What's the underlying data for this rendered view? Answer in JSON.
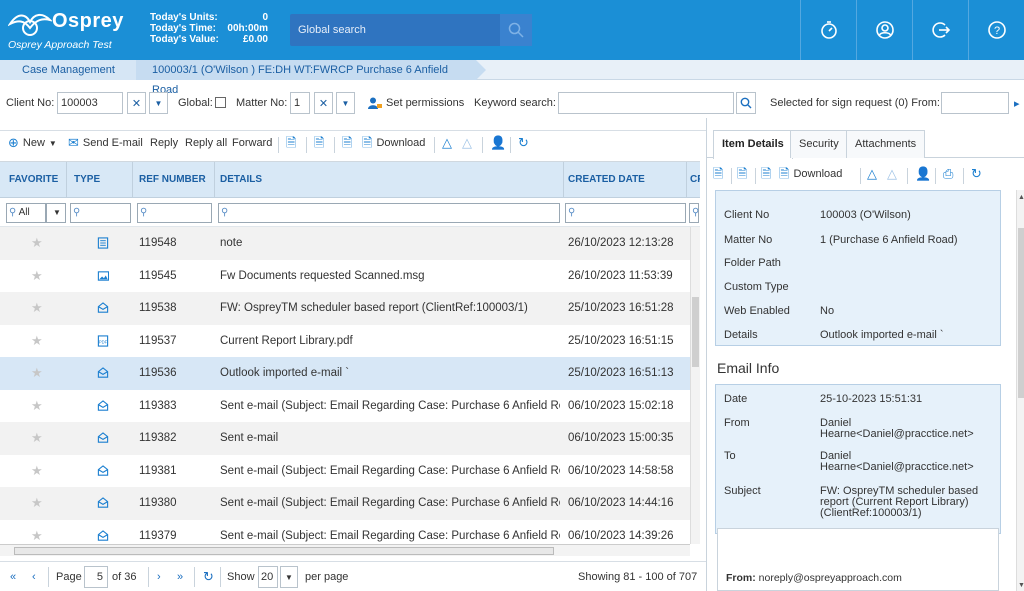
{
  "header": {
    "brand": "Osprey",
    "brand_sub": "Osprey Approach Test",
    "stats": [
      {
        "label": "Today's Units:",
        "value": "0"
      },
      {
        "label": "Today's Time:",
        "value": "00h:00m"
      },
      {
        "label": "Today's Value:",
        "value": "£0.00"
      }
    ],
    "search_placeholder": "Global search",
    "icons": [
      "stopwatch-icon",
      "user-icon",
      "logout-icon",
      "help-icon"
    ]
  },
  "breadcrumb": [
    "Case Management",
    "100003/1 (O'Wilson ) FE:DH WT:FWRCP Purchase 6 Anfield Road"
  ],
  "filters": {
    "client_label": "Client No:",
    "client_value": "100003",
    "global_label": "Global:",
    "matter_label": "Matter No:",
    "matter_value": "1",
    "permissions": "Set permissions",
    "keyword_label": "Keyword search:",
    "sign_label": "Selected for sign request (0) From:"
  },
  "toolbar": {
    "new": "New",
    "send_email": "Send E-mail",
    "reply": "Reply",
    "reply_all": "Reply all",
    "forward": "Forward",
    "download": "Download"
  },
  "grid": {
    "columns": [
      "FAVORITE",
      "TYPE",
      "REF NUMBER",
      "DETAILS",
      "CREATED DATE",
      "CR"
    ],
    "fav_filter": "All",
    "rows": [
      {
        "type": "note",
        "ref": "119548",
        "details": "note",
        "created": "26/10/2023 12:13:28"
      },
      {
        "type": "image",
        "ref": "119545",
        "details": "Fw Documents requested Scanned.msg",
        "created": "26/10/2023 11:53:39"
      },
      {
        "type": "email",
        "ref": "119538",
        "details": "FW: OspreyTM scheduler based report (ClientRef:100003/1)",
        "created": "25/10/2023 16:51:28"
      },
      {
        "type": "pdf",
        "ref": "119537",
        "details": "Current Report Library.pdf",
        "created": "25/10/2023 16:51:15"
      },
      {
        "type": "email",
        "ref": "119536",
        "details": "Outlook imported e-mail `",
        "created": "25/10/2023 16:51:13"
      },
      {
        "type": "email",
        "ref": "119383",
        "details": "Sent e-mail (Subject: Email Regarding Case: Purchase 6 Anfield Ro...",
        "created": "06/10/2023 15:02:18"
      },
      {
        "type": "email",
        "ref": "119382",
        "details": "Sent e-mail",
        "created": "06/10/2023 15:00:35"
      },
      {
        "type": "email",
        "ref": "119381",
        "details": "Sent e-mail (Subject: Email Regarding Case: Purchase 6 Anfield Ro...",
        "created": "06/10/2023 14:58:58"
      },
      {
        "type": "email",
        "ref": "119380",
        "details": "Sent e-mail (Subject: Email Regarding Case: Purchase 6 Anfield Ro...",
        "created": "06/10/2023 14:44:16"
      },
      {
        "type": "email",
        "ref": "119379",
        "details": "Sent e-mail (Subject: Email Regarding Case: Purchase 6 Anfield Ro...",
        "created": "06/10/2023 14:39:26"
      }
    ]
  },
  "pager": {
    "page_label": "Page",
    "page_value": "5",
    "of": "of 36",
    "show_label": "Show",
    "show_value": "20",
    "per_page": "per page",
    "showing": "Showing 81 - 100 of 707"
  },
  "panel": {
    "tabs": [
      "Item Details",
      "Security",
      "Attachments"
    ],
    "download": "Download",
    "details": [
      {
        "label": "Client No",
        "value": "100003 (O'Wilson)"
      },
      {
        "label": "Matter No",
        "value": "1 (Purchase 6 Anfield Road)"
      },
      {
        "label": "Folder Path",
        "value": ""
      },
      {
        "label": "Custom Type",
        "value": ""
      },
      {
        "label": "Web Enabled",
        "value": "No"
      },
      {
        "label": "Details",
        "value": "Outlook imported e-mail `"
      }
    ],
    "email_title": "Email Info",
    "email": {
      "date_label": "Date",
      "date": "25-10-2023 15:51:31",
      "from_label": "From",
      "from_1": "Daniel",
      "from_2": "Hearne<Daniel@pracctice.net>",
      "to_label": "To",
      "to_1": "Daniel",
      "to_2": "Hearne<Daniel@pracctice.net>",
      "subject_label": "Subject",
      "subject_1": "FW: OspreyTM scheduler based",
      "subject_2": "report (Current Report Library)",
      "subject_3": "(ClientRef:100003/1)"
    },
    "preview_from_label": "From:",
    "preview_from": "noreply@ospreyapproach.com"
  },
  "colors": {
    "header": "#1b8fd6",
    "accent": "#1b5fa3",
    "selected_row": "#d7e7f6"
  }
}
